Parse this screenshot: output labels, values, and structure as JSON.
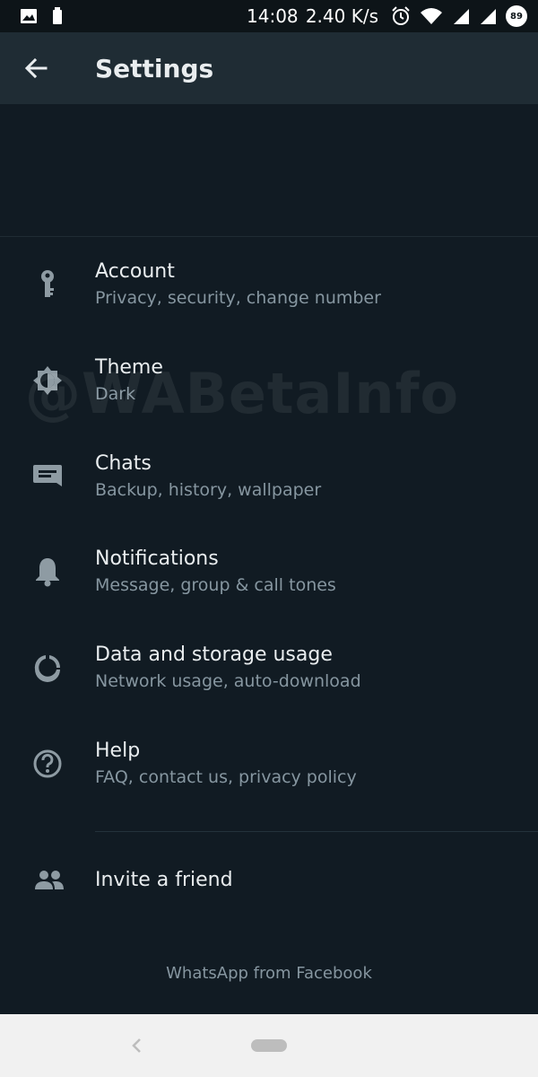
{
  "status_bar": {
    "time": "14:08",
    "speed": "2.40 K/s",
    "battery": "89",
    "icons": [
      "image-icon",
      "battery-saver-icon",
      "alarm-icon",
      "wifi-icon",
      "signal-icon",
      "signal-icon-2"
    ]
  },
  "app_bar": {
    "title": "Settings",
    "back_icon": "arrow-left-icon"
  },
  "settings": {
    "items": [
      {
        "title": "Account",
        "subtitle": "Privacy, security, change number",
        "icon": "key-icon"
      },
      {
        "title": "Theme",
        "subtitle": "Dark",
        "icon": "theme-icon"
      },
      {
        "title": "Chats",
        "subtitle": "Backup, history, wallpaper",
        "icon": "chat-icon"
      },
      {
        "title": "Notifications",
        "subtitle": "Message, group & call tones",
        "icon": "bell-icon"
      },
      {
        "title": "Data and storage usage",
        "subtitle": "Network usage, auto-download",
        "icon": "data-usage-icon"
      },
      {
        "title": "Help",
        "subtitle": "FAQ, contact us, privacy policy",
        "icon": "help-icon"
      }
    ],
    "invite": {
      "title": "Invite a friend",
      "icon": "people-icon"
    }
  },
  "footer": "WhatsApp from Facebook",
  "watermark": "@WABetaInfo",
  "colors": {
    "background": "#111b23",
    "app_bar": "#1f2c34",
    "icon": "#8e9ba3",
    "subtitle": "#8696a0"
  }
}
